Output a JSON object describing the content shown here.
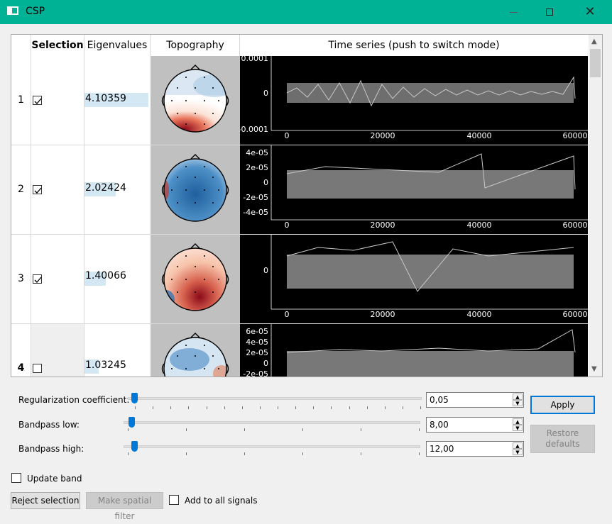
{
  "window": {
    "title": "CSP"
  },
  "table": {
    "headers": [
      "Selection",
      "Eigenvalues",
      "Topography",
      "Time series (push to switch mode)"
    ],
    "rows": [
      {
        "num": "1",
        "selected": true,
        "eigenvalue": "4.10359",
        "yticks": [
          "0.0001",
          "0",
          "-0.0001"
        ]
      },
      {
        "num": "2",
        "selected": true,
        "eigenvalue": "2.02424",
        "yticks": [
          "4e-05",
          "2e-05",
          "0",
          "-2e-05",
          "-4e-05"
        ]
      },
      {
        "num": "3",
        "selected": true,
        "eigenvalue": "1.40066",
        "yticks": [
          "0"
        ]
      },
      {
        "num": "4",
        "selected": false,
        "eigenvalue": "1.03245",
        "yticks": [
          "6e-05",
          "4e-05",
          "2e-05",
          "0",
          "-2e-05"
        ]
      }
    ],
    "xticks": [
      "0",
      "20000",
      "40000",
      "60000"
    ]
  },
  "controls": {
    "regularization": {
      "label": "Regularization coefficient:",
      "value": "0,05"
    },
    "bandpass_low": {
      "label": "Bandpass low:",
      "value": "8,00"
    },
    "bandpass_high": {
      "label": "Bandpass high:",
      "value": "12,00"
    },
    "apply_label": "Apply",
    "restore_label": "Restore\ndefaults",
    "update_band_label": "Update band",
    "reject_label": "Reject selection",
    "make_filter_label": "Make spatial filter",
    "add_all_label": "Add to all signals"
  },
  "colors": {
    "titlebar": "#00b295",
    "accent": "#0078d7",
    "eigen_bar": "#d4e8f4"
  },
  "icons": {
    "app": "window-icon",
    "minimize": "minimize-icon",
    "maximize": "maximize-icon",
    "close": "close-icon"
  }
}
